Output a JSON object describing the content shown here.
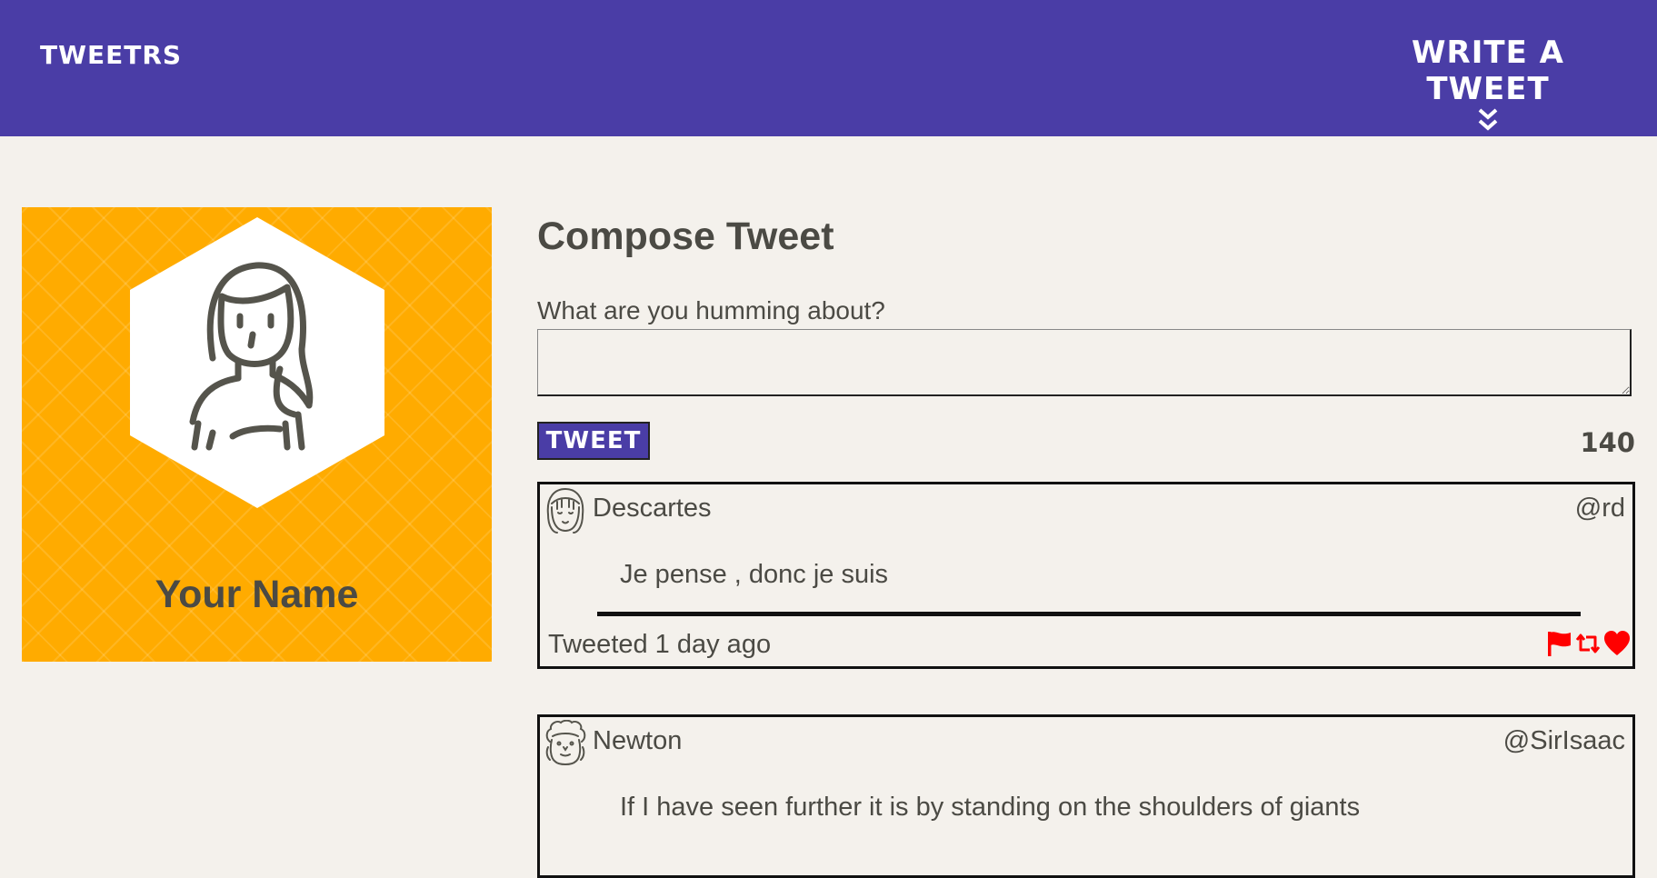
{
  "nav": {
    "brand": "TWEETRS",
    "write_label": "WRITE A TWEET",
    "write_icon": "double-chevron-down-icon"
  },
  "profile": {
    "name": "Your Name",
    "background_color": "#ffab00",
    "avatar_icon": "user-avatar-icon"
  },
  "compose": {
    "title": "Compose Tweet",
    "label": "What are you humming about?",
    "input_value": "",
    "button_label": "TWEET",
    "counter": "140"
  },
  "tweets": [
    {
      "name": "Descartes",
      "handle": "@rd",
      "content": "Je pense , donc je suis",
      "time": "Tweeted 1 day ago",
      "avatar_icon": "descartes-avatar-icon",
      "actions": [
        "flag-icon",
        "retweet-icon",
        "heart-icon"
      ]
    },
    {
      "name": "Newton",
      "handle": "@SirIsaac",
      "content": "If I have seen further it is by standing on the shoulders of giants",
      "avatar_icon": "newton-avatar-icon"
    }
  ],
  "colors": {
    "nav": "#4a3da6",
    "accent": "#ffab00",
    "background": "#f4f1ec",
    "text": "#4b4a44",
    "action": "#ff0000"
  }
}
